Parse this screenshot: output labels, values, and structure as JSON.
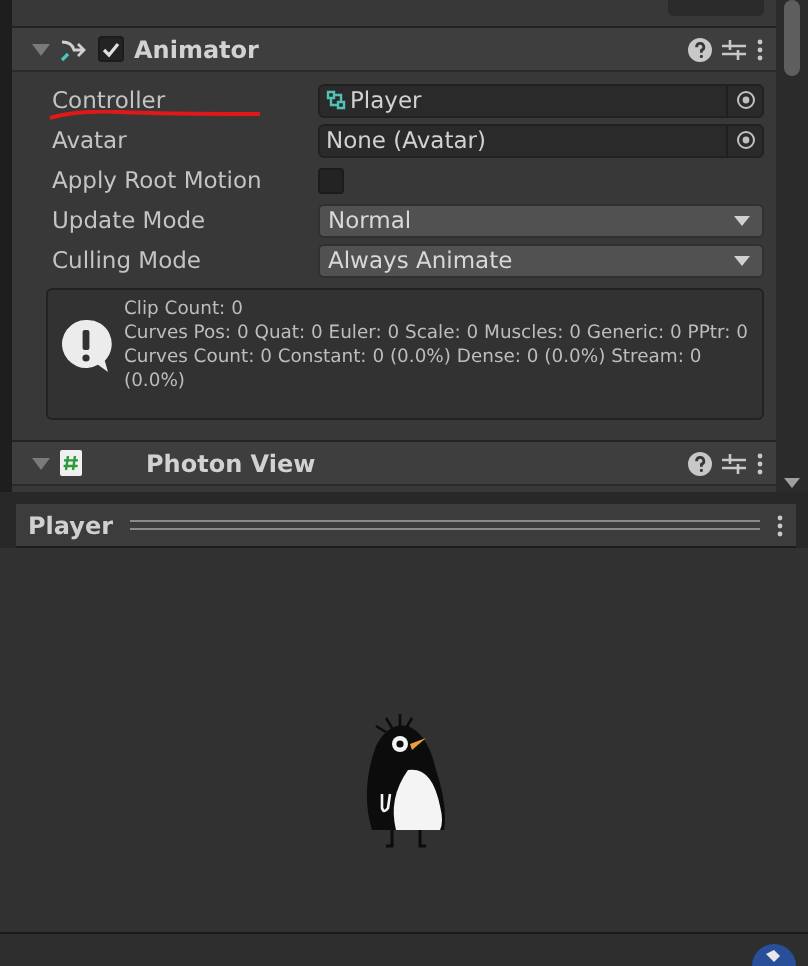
{
  "component": {
    "title": "Animator",
    "enabled": true,
    "expanded": true,
    "fields": [
      {
        "kind": "object",
        "label": "Controller",
        "value": "Player",
        "has_asset_icon": true,
        "underlined": true
      },
      {
        "kind": "object",
        "label": "Avatar",
        "value": "None (Avatar)",
        "has_asset_icon": false,
        "underlined": false
      },
      {
        "kind": "checkbox",
        "label": "Apply Root Motion",
        "checked": false
      },
      {
        "kind": "dropdown",
        "label": "Update Mode",
        "value": "Normal"
      },
      {
        "kind": "dropdown",
        "label": "Culling Mode",
        "value": "Always Animate"
      }
    ],
    "info_lines": [
      "Clip Count: 0",
      "Curves Pos: 0 Quat: 0 Euler: 0 Scale: 0 Muscles: 0 Generic: 0 PPtr: 0",
      "Curves Count: 0 Constant: 0 (0.0%) Dense: 0 (0.0%) Stream: 0 (0.0%)"
    ]
  },
  "next_component": {
    "title": "Photon View",
    "expanded": true
  },
  "preview": {
    "title": "Player"
  }
}
